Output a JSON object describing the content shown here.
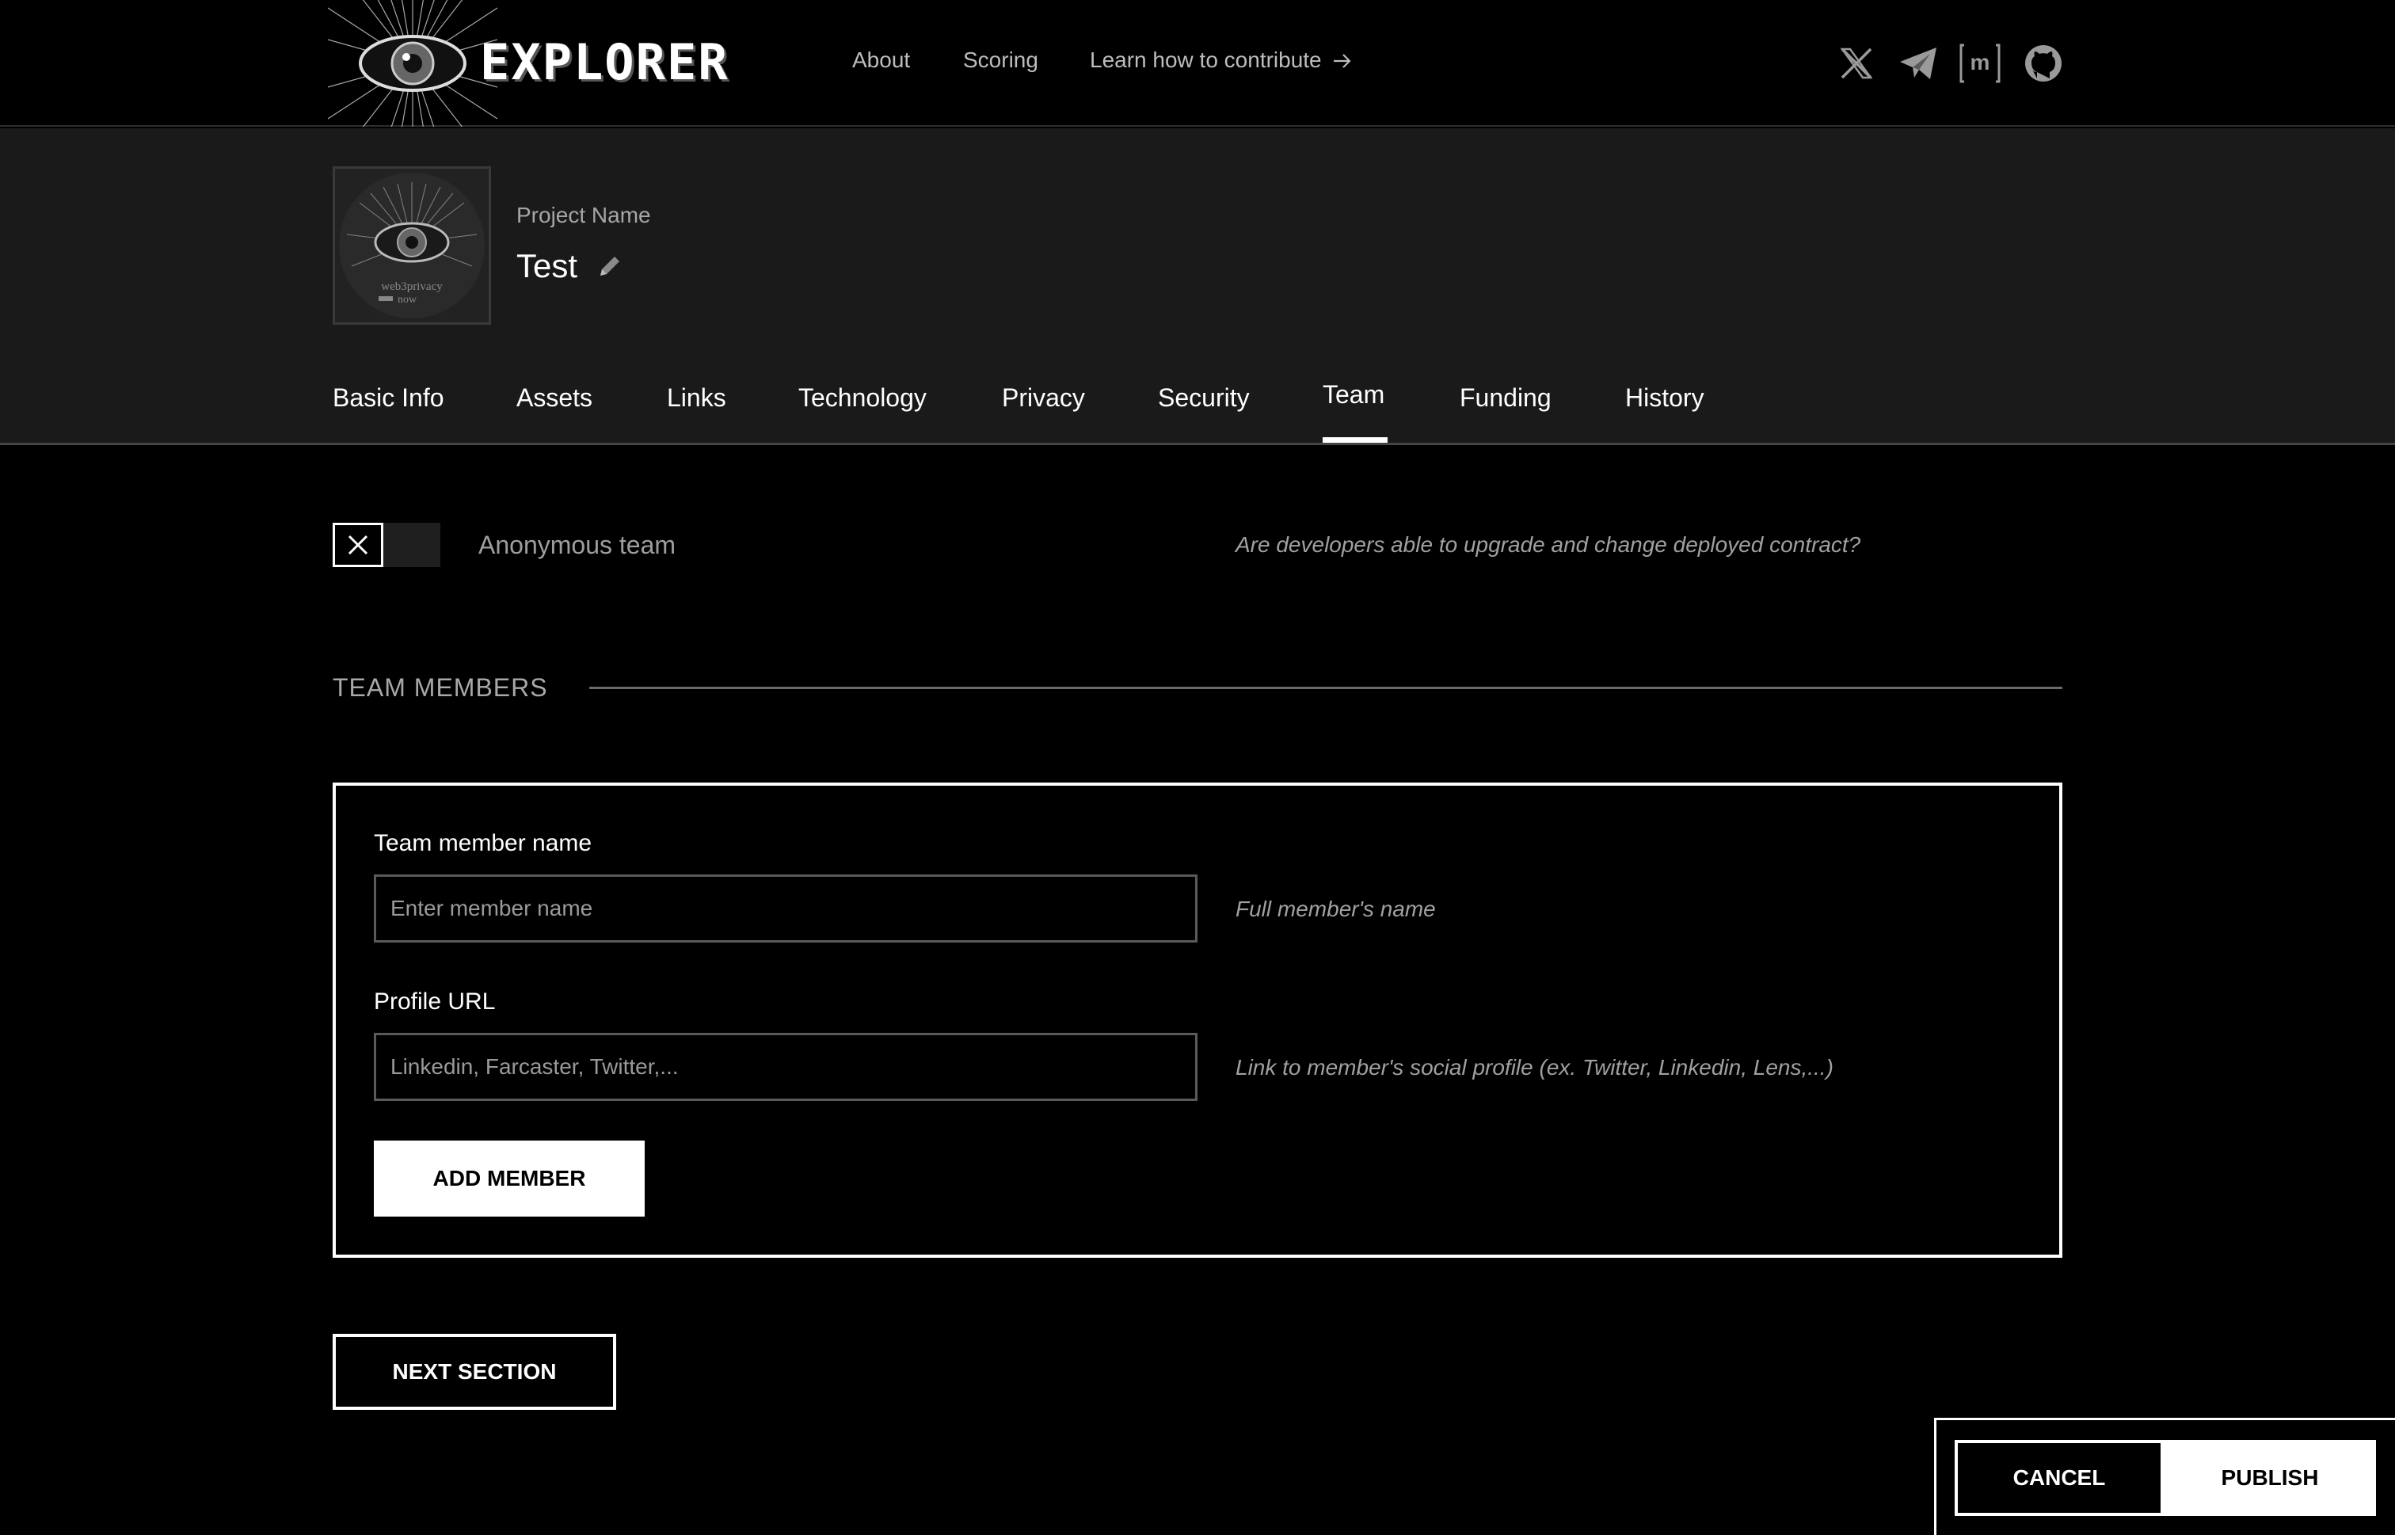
{
  "header": {
    "logo_text": "EXPLORER",
    "nav": [
      {
        "label": "About"
      },
      {
        "label": "Scoring"
      },
      {
        "label": "Learn how to contribute"
      }
    ],
    "social": [
      "x-icon",
      "telegram-icon",
      "matrix-icon",
      "github-icon"
    ]
  },
  "project": {
    "name_label": "Project Name",
    "name": "Test",
    "avatar_text_1": "web3privacy",
    "avatar_text_2": "now"
  },
  "tabs": [
    {
      "label": "Basic Info"
    },
    {
      "label": "Assets"
    },
    {
      "label": "Links"
    },
    {
      "label": "Technology"
    },
    {
      "label": "Privacy"
    },
    {
      "label": "Security"
    },
    {
      "label": "Team",
      "active": true
    },
    {
      "label": "Funding"
    },
    {
      "label": "History"
    }
  ],
  "team": {
    "anonymous_label": "Anonymous team",
    "anonymous_value": false,
    "anonymous_hint": "Are developers able to upgrade and change deployed contract?",
    "section_title": "TEAM MEMBERS",
    "member_name_label": "Team member name",
    "member_name_placeholder": "Enter member name",
    "member_name_value": "",
    "member_name_hint": "Full member's name",
    "profile_url_label": "Profile URL",
    "profile_url_placeholder": "Linkedin, Farcaster, Twitter,...",
    "profile_url_value": "",
    "profile_url_hint": "Link to member's social profile (ex. Twitter, Linkedin, Lens,...)",
    "add_member_label": "ADD MEMBER"
  },
  "actions": {
    "next_section_label": "NEXT SECTION",
    "cancel_label": "CANCEL",
    "publish_label": "PUBLISH"
  },
  "colors": {
    "background": "#000000",
    "band": "#1a1a1a",
    "text": "#ffffff",
    "muted": "#a0a0a0"
  }
}
